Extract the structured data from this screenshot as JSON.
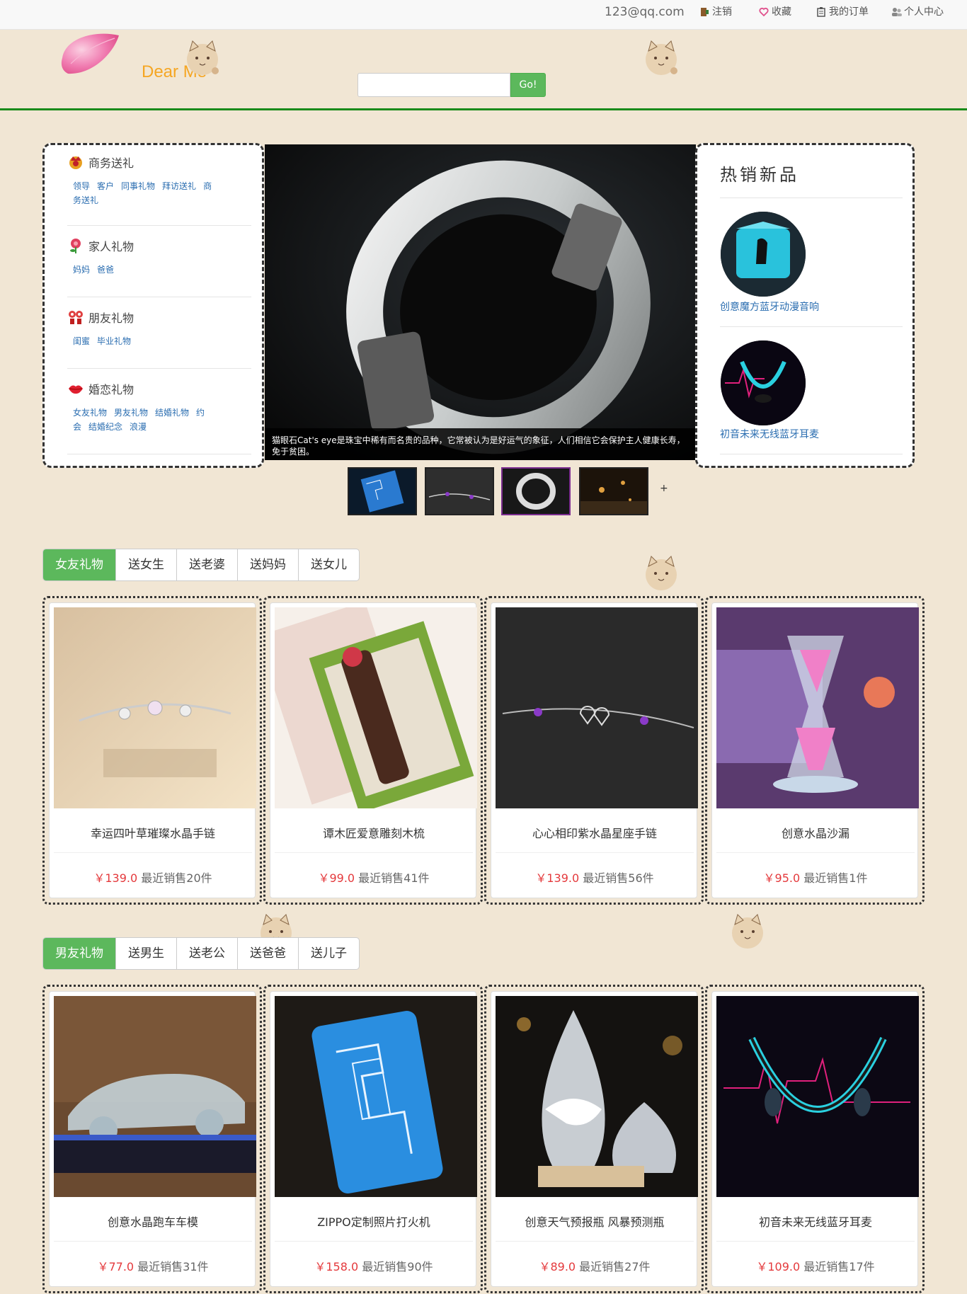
{
  "topbar": {
    "email": "123@qq.com",
    "logout": "注销",
    "favorites": "收藏",
    "orders": "我的订单",
    "profile": "个人中心"
  },
  "header": {
    "brand": "Dear Me",
    "search_placeholder": "",
    "search_button": "Go!"
  },
  "categories": [
    {
      "title": "商务送礼",
      "icon": "crown-gift-icon",
      "links": [
        "领导",
        "客户",
        "同事礼物",
        "拜访送礼",
        "商务送礼"
      ]
    },
    {
      "title": "家人礼物",
      "icon": "flower-icon",
      "links": [
        "妈妈",
        "爸爸"
      ]
    },
    {
      "title": "朋友礼物",
      "icon": "friends-icon",
      "links": [
        "闺蜜",
        "毕业礼物"
      ]
    },
    {
      "title": "婚恋礼物",
      "icon": "lips-icon",
      "links": [
        "女友礼物",
        "男友礼物",
        "结婚礼物",
        "约会",
        "结婚纪念",
        "浪漫"
      ]
    }
  ],
  "carousel": {
    "caption": "猫眼石Cat's eye是珠宝中稀有而名贵的品种，它常被认为是好运气的象征，人们相信它会保护主人健康长寿，免于贫困。",
    "more": "+"
  },
  "hot": {
    "title": "热销新品",
    "items": [
      {
        "name": "创意魔方蓝牙动漫音响"
      },
      {
        "name": "初音未来无线蓝牙耳麦"
      }
    ]
  },
  "section1": {
    "tabs": [
      "女友礼物",
      "送女生",
      "送老婆",
      "送妈妈",
      "送女儿"
    ],
    "products": [
      {
        "name": "幸运四叶草璀璨水晶手链",
        "price": "￥139.0",
        "sales": " 最近销售20件"
      },
      {
        "name": "谭木匠爱意雕刻木梳",
        "price": "￥99.0",
        "sales": " 最近销售41件"
      },
      {
        "name": "心心相印紫水晶星座手链",
        "price": "￥139.0",
        "sales": " 最近销售56件"
      },
      {
        "name": "创意水晶沙漏",
        "price": "￥95.0",
        "sales": " 最近销售1件"
      }
    ]
  },
  "section2": {
    "tabs": [
      "男友礼物",
      "送男生",
      "送老公",
      "送爸爸",
      "送儿子"
    ],
    "products": [
      {
        "name": "创意水晶跑车车模",
        "price": "￥77.0",
        "sales": " 最近销售31件"
      },
      {
        "name": "ZIPPO定制照片打火机",
        "price": "￥158.0",
        "sales": " 最近销售90件"
      },
      {
        "name": "创意天气预报瓶 风暴预测瓶",
        "price": "￥89.0",
        "sales": " 最近销售27件"
      },
      {
        "name": "初音未来无线蓝牙耳麦",
        "price": "￥109.0",
        "sales": " 最近销售17件"
      }
    ]
  },
  "colors": {
    "accent_green": "#5cb85c",
    "header_rule": "#1a8a1a",
    "price_red": "#e4393c",
    "brand_orange": "#f5a623",
    "background": "#f1e6d4"
  }
}
